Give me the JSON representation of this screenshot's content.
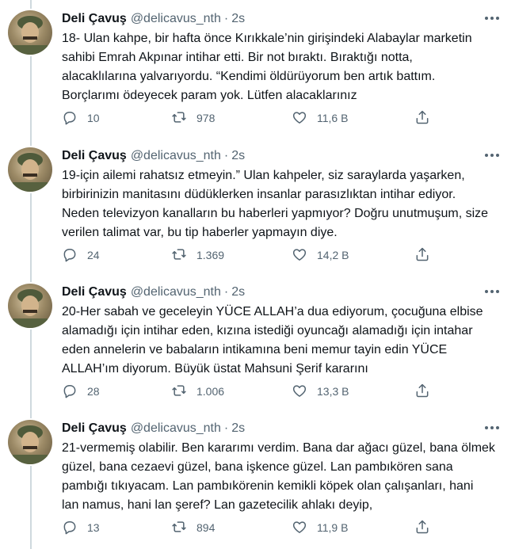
{
  "tweets": [
    {
      "name": "Deli Çavuş",
      "handle": "@delicavus_nth",
      "dot": "·",
      "time": "2s",
      "text": "18- Ulan kahpe, bir hafta önce Kırıkkale’nin girişindeki Alabaylar marketin\nsahibi Emrah Akpınar intihar etti. Bir not bıraktı. Bıraktığı notta,\nalacaklılarına yalvarıyordu. “Kendimi öldürüyorum ben artık battım.\nBorçlarımı ödeyecek param yok. Lütfen alacaklarınız",
      "replies": "10",
      "retweets": "978",
      "likes": "11,6 B"
    },
    {
      "name": "Deli Çavuş",
      "handle": "@delicavus_nth",
      "dot": "·",
      "time": "2s",
      "text": "19-için ailemi rahatsız etmeyin.” Ulan kahpeler, siz saraylarda yaşarken,\nbirbirinizin manitasını düdüklerken insanlar parasızlıktan intihar ediyor.\nNeden televizyon kanalların bu haberleri yapmıyor? Doğru unutmuşum, size\nverilen talimat var,  bu tip haberler yapmayın diye.",
      "replies": "24",
      "retweets": "1.369",
      "likes": "14,2 B"
    },
    {
      "name": "Deli Çavuş",
      "handle": "@delicavus_nth",
      "dot": "·",
      "time": "2s",
      "text": "20-Her sabah ve geceleyin YÜCE ALLAH’a dua ediyorum, çocuğuna elbise\nalamadığı için intihar eden, kızına istediği oyuncağı alamadığı için intahar\neden annelerin ve babaların intikamına beni memur tayin edin YÜCE\nALLAH’ım diyorum. Büyük üstat  Mahsuni Şerif kararını",
      "replies": "28",
      "retweets": "1.006",
      "likes": "13,3 B"
    },
    {
      "name": "Deli Çavuş",
      "handle": "@delicavus_nth",
      "dot": "·",
      "time": "2s",
      "text": "21-vermemiş olabilir. Ben kararımı verdim. Bana dar ağacı güzel, bana ölmek\ngüzel, bana cezaevi güzel, bana işkence güzel. Lan pambıkören sana\npambığı tıkıyacam. Lan pambıkörenin kemikli köpek olan çalışanları, hani\nlan namus, hani lan şeref? Lan gazetecilik ahlakı deyip,",
      "replies": "13",
      "retweets": "894",
      "likes": "11,9 B"
    }
  ],
  "icons": {
    "reply": "reply-icon",
    "retweet": "retweet-icon",
    "like": "heart-icon",
    "share": "share-icon",
    "more": "more-icon"
  },
  "colors": {
    "text": "#0f1419",
    "secondary": "#536471",
    "thread_line": "#cfd9de",
    "divider": "#eff3f4"
  }
}
